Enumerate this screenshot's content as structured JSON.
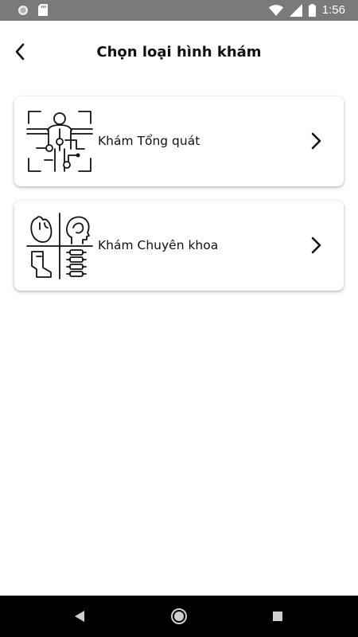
{
  "status_bar": {
    "time": "1:56",
    "icons": [
      "notification-dot-icon",
      "sd-card-icon",
      "wifi-icon",
      "cellular-icon",
      "battery-icon"
    ]
  },
  "header": {
    "title": "Chọn loại hình khám",
    "back_icon": "chevron-left-icon"
  },
  "cards": [
    {
      "label": "Khám Tổng quát",
      "icon": "body-scan-icon",
      "action_icon": "chevron-right-icon"
    },
    {
      "label": "Khám Chuyên khoa",
      "icon": "specialty-organs-icon",
      "action_icon": "chevron-right-icon"
    }
  ],
  "nav_bar": {
    "icons": [
      "nav-back-icon",
      "nav-home-icon",
      "nav-recents-icon"
    ]
  },
  "colors": {
    "status_bar": "#7a7a7a",
    "nav_bar": "#000000",
    "background": "#ffffff",
    "text": "#111111"
  }
}
